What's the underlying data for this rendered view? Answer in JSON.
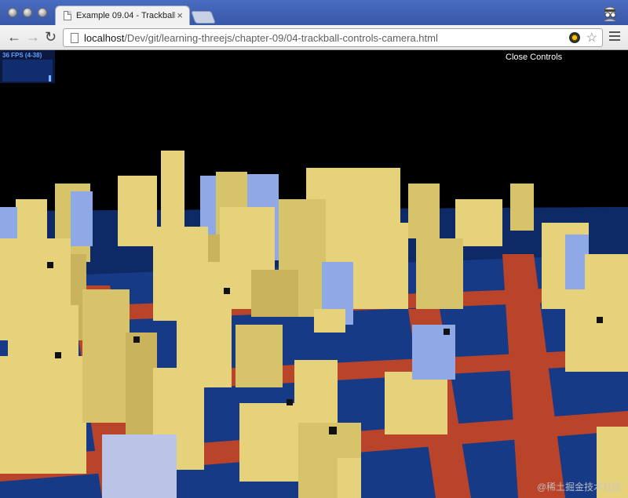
{
  "browser": {
    "tab_title": "Example 09.04 - Trackball",
    "tab_close": "×",
    "url_host": "localhost",
    "url_path": "/Dev/git/learning-threejs/chapter-09/04-trackball-controls-camera.html",
    "back_glyph": "←",
    "forward_glyph": "→",
    "reload_glyph": "↻",
    "star_glyph": "☆"
  },
  "viewport": {
    "stats_fps": "36 FPS (4-38)",
    "close_controls": "Close Controls",
    "watermark": "@稀土掘金技术社区"
  },
  "colors": {
    "building": "#e6d27a",
    "building_side": "#c9b35d",
    "building_blue": "#8fa8e6",
    "road_red": "#b9442a",
    "ground": "#163a86",
    "chrome_blue": "#3b5aa6"
  },
  "icons": [
    "page-icon",
    "search-ext-icon",
    "star-icon",
    "menu-icon",
    "incognito-icon"
  ]
}
